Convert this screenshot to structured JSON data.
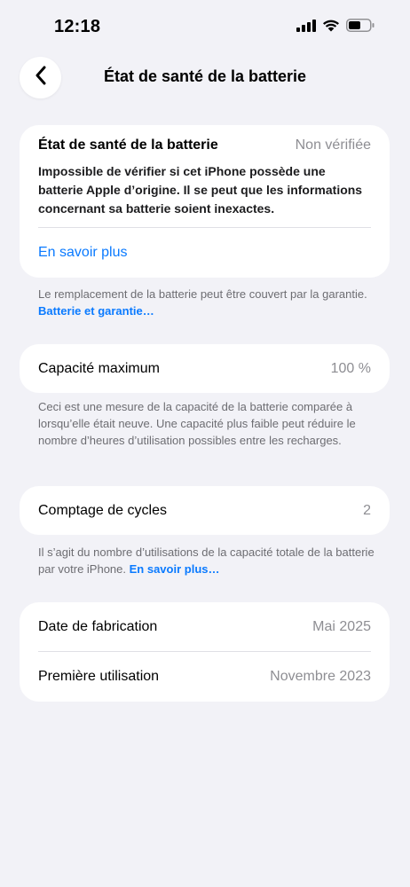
{
  "status_bar": {
    "time": "12:18",
    "icons": [
      "signal-icon",
      "wifi-icon",
      "battery-icon"
    ]
  },
  "nav": {
    "title": "État de santé de la batterie",
    "back_icon": "chevron-left-icon"
  },
  "health_card": {
    "title": "État de santé de la batterie",
    "status": "Non vérifiée",
    "description": "Impossible de vérifier si cet iPhone possède une batterie Apple d’origine. Il se peut que les informations concernant sa batterie soient inexactes.",
    "learn_more": "En savoir plus"
  },
  "health_footnote": {
    "text": "Le remplacement de la batterie peut être couvert par la garantie. ",
    "link": "Batterie et garantie…"
  },
  "capacity": {
    "label": "Capacité maximum",
    "value": "100 %",
    "footnote": "Ceci est une mesure de la capacité de la batterie comparée à lorsqu’elle était neuve. Une capacité plus faible peut réduire le nombre d’heures d’utilisation possibles entre les recharges."
  },
  "cycles": {
    "label": "Comptage de cycles",
    "value": "2",
    "footnote": "Il s’agit du nombre d’utilisations de la capacité totale de la batterie par votre iPhone. ",
    "footnote_link": "En savoir plus…"
  },
  "dates": {
    "manufacture_label": "Date de fabrication",
    "manufacture_value": "Mai 2025",
    "first_use_label": "Première utilisation",
    "first_use_value": "Novembre 2023"
  },
  "colors": {
    "background": "#f2f2f7",
    "card": "#ffffff",
    "link": "#0a7aff",
    "secondary_text": "#8e8e93"
  }
}
